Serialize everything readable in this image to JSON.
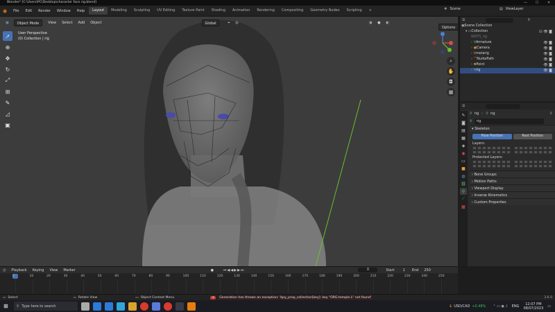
{
  "window": {
    "title": "Blender* [C:\\Users\\PC\\Desktop\\character face rig.blend]"
  },
  "menubar": {
    "menus": [
      "File",
      "Edit",
      "Render",
      "Window",
      "Help"
    ],
    "workspaces": [
      "Layout",
      "Modeling",
      "Sculpting",
      "UV Editing",
      "Texture Paint",
      "Shading",
      "Animation",
      "Rendering",
      "Compositing",
      "Geometry Nodes",
      "Scripting"
    ],
    "active_workspace": "Layout",
    "add_tab": "+",
    "scene_label": "Scene",
    "view_layer_label": "ViewLayer"
  },
  "viewport_header": {
    "mode": "Object Mode",
    "menus": [
      "View",
      "Select",
      "Add",
      "Object"
    ],
    "orientation": "Global",
    "options": "Options"
  },
  "viewport": {
    "perspective": "User Perspective",
    "collection_info": "(0) Collection | rig"
  },
  "outliner": {
    "search_placeholder": "",
    "root": "Scene Collection",
    "collection": "Collection",
    "disabled_item": "WGTS_rig",
    "items": [
      "Armature",
      "Camera",
      "metarig",
      "NurbsPath",
      "Point",
      "rig"
    ],
    "selected": "rig"
  },
  "properties": {
    "breadcrumb_object": "rig",
    "breadcrumb_data": "rig",
    "data_name": "rig",
    "skeleton_header": "Skeleton",
    "pose_position": "Pose Position",
    "rest_position": "Rest Position",
    "layers_label": "Layers:",
    "protected_layers_label": "Protected Layers:",
    "collapsed_panels": [
      "Bone Groups",
      "Motion Paths",
      "Viewport Display",
      "Inverse Kinematics",
      "Custom Properties"
    ]
  },
  "timeline": {
    "menus": [
      "Playback",
      "Keying",
      "View",
      "Marker"
    ],
    "current_frame": "0",
    "start_label": "Start",
    "start": "1",
    "end_label": "End",
    "end": "250",
    "ticks": [
      "0",
      "10",
      "20",
      "30",
      "40",
      "50",
      "60",
      "70",
      "80",
      "90",
      "100",
      "110",
      "120",
      "130",
      "140",
      "150",
      "160",
      "170",
      "180",
      "190",
      "200",
      "210",
      "220",
      "230",
      "240",
      "250"
    ]
  },
  "statusbar": {
    "select": "Select",
    "rotate_view": "Rotate View",
    "object_menu": "Object Context Menu",
    "error": "Generation has thrown an exception: 'bpy_prop_collection[key]: key \"ORG-temple.L\" not found'",
    "version": "3.6.0"
  },
  "taskbar": {
    "search_placeholder": "Type here to search",
    "ticker": "USD/CAD",
    "ticker_change": "+0.48%",
    "lang": "ENG",
    "time": "12:07 PM",
    "date": "08/07/2023"
  },
  "colors": {
    "accent": "#4772b3",
    "selection": "#334d80",
    "error": "#c0392b",
    "ticker_up": "#3fbf5a"
  }
}
